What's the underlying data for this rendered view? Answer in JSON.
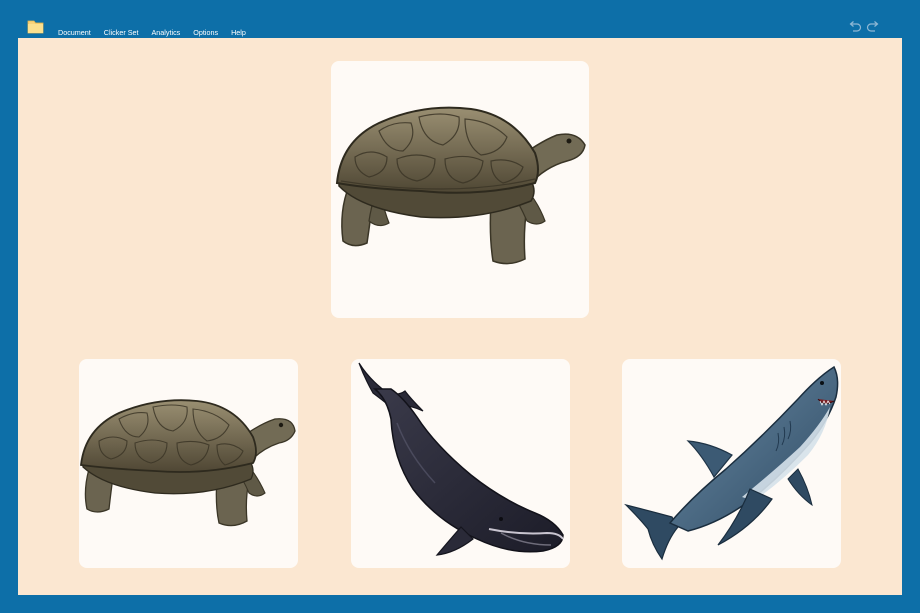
{
  "menu": {
    "items": [
      "Document",
      "Clicker Set",
      "Analytics",
      "Options",
      "Help"
    ]
  },
  "icons": {
    "folder": "folder-icon",
    "undo": "undo-icon",
    "redo": "redo-icon"
  },
  "colors": {
    "frame": "#0d6fa8",
    "workspace": "#fbe7d1",
    "card": "#fefaf6"
  },
  "prompt": {
    "image": "tortoise"
  },
  "choices": [
    {
      "image": "tortoise"
    },
    {
      "image": "whale"
    },
    {
      "image": "shark"
    }
  ]
}
